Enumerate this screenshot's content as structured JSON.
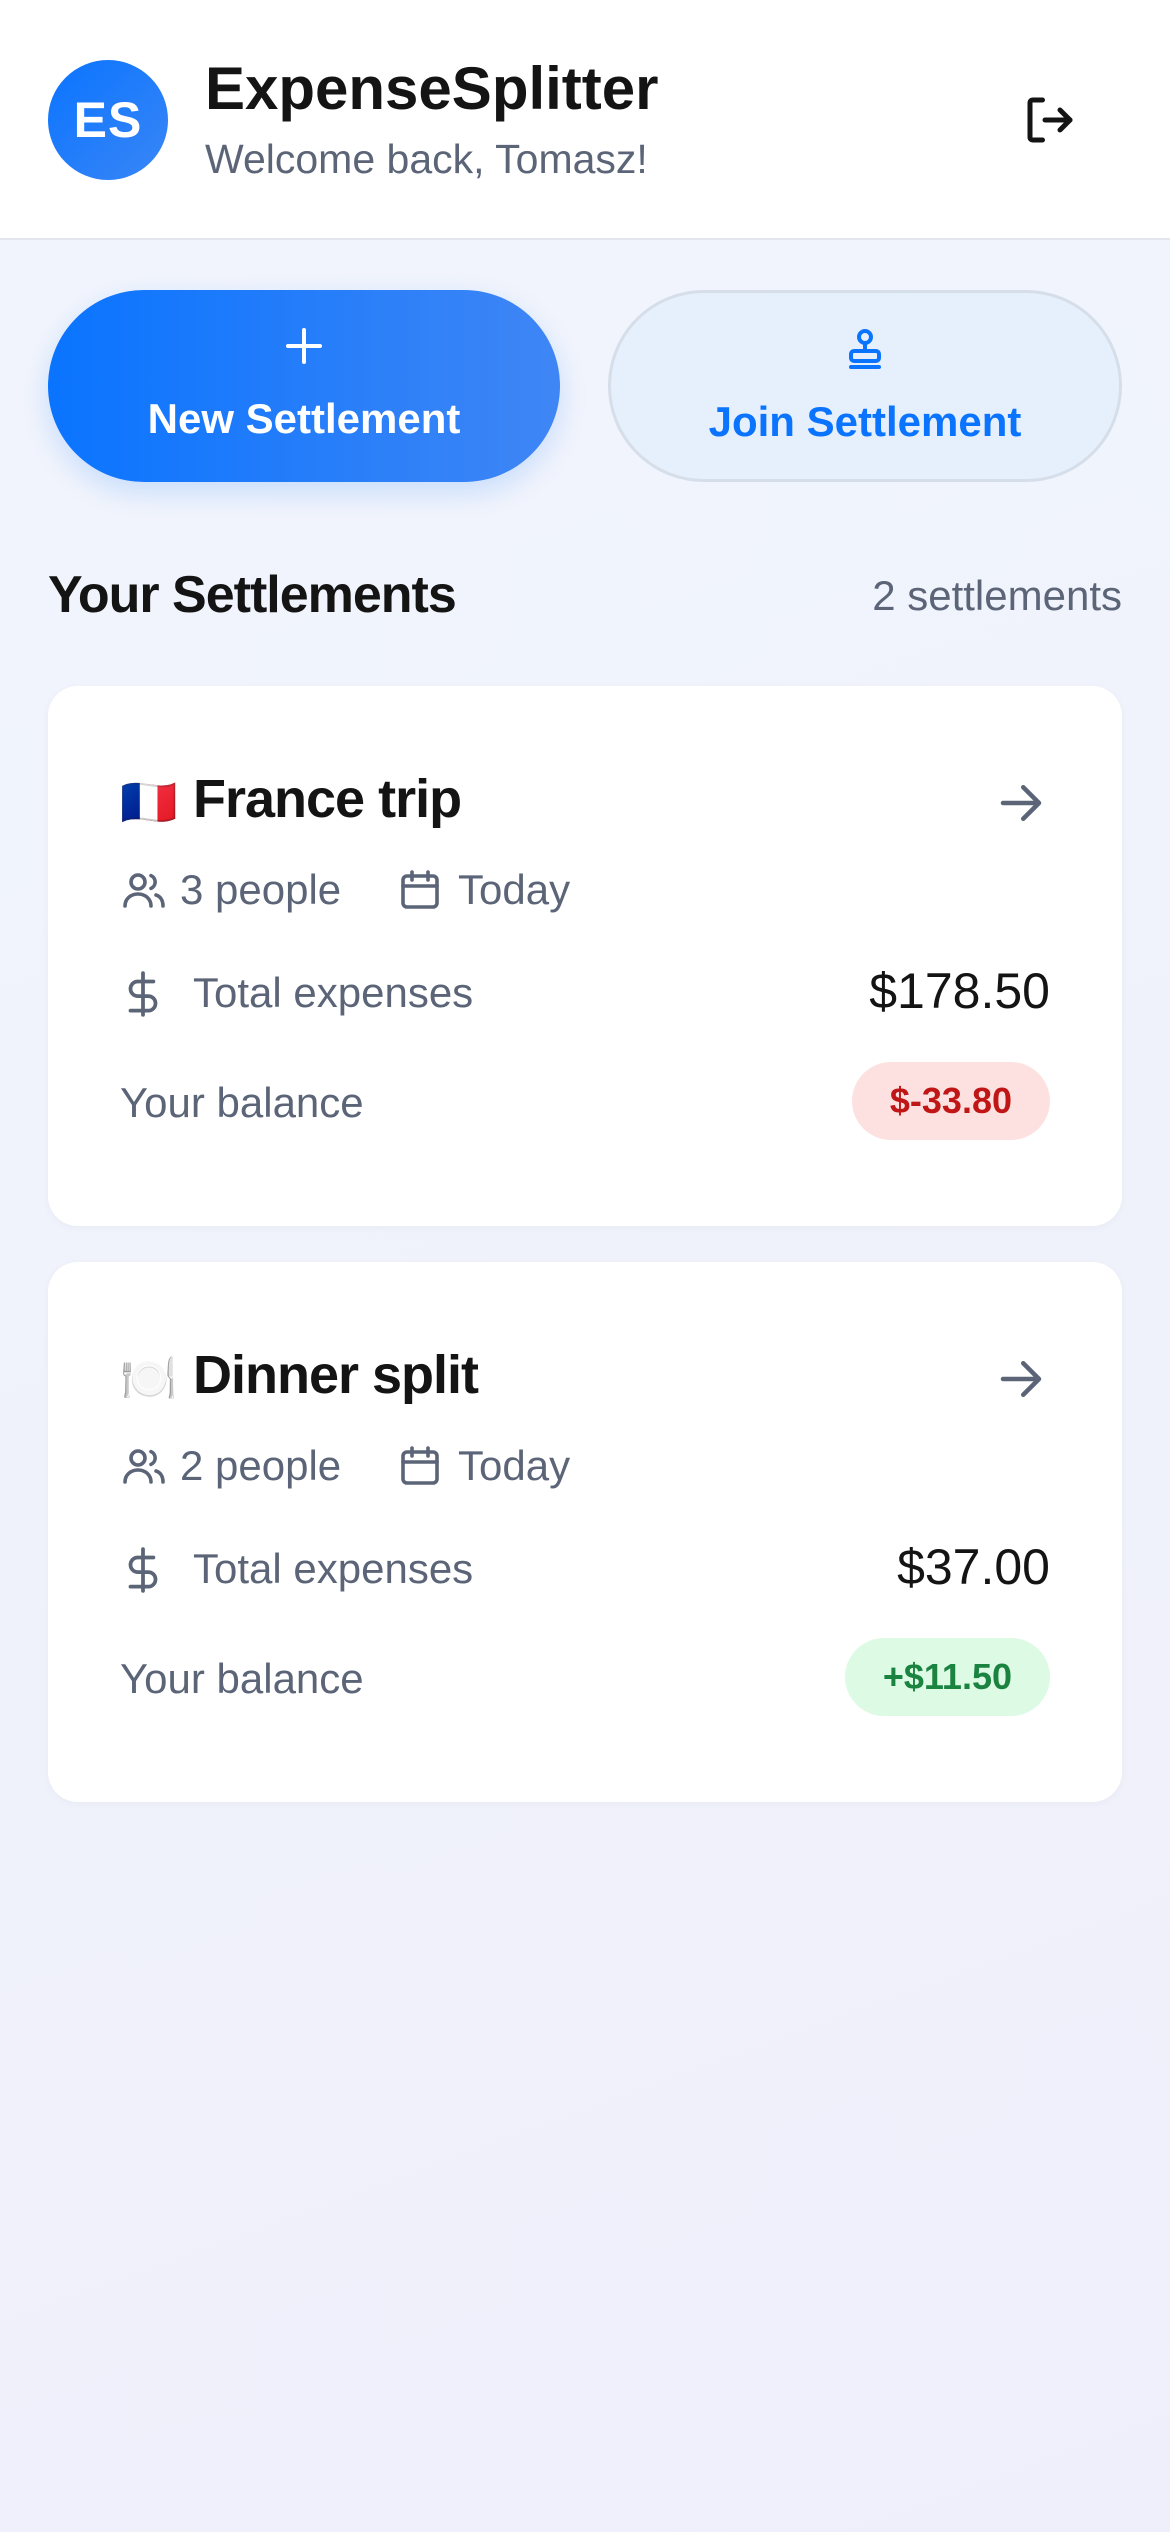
{
  "header": {
    "avatar_initials": "ES",
    "app_title": "ExpenseSplitter",
    "welcome": "Welcome back, Tomasz!",
    "logout_icon": "logout-icon"
  },
  "actions": {
    "new_label": "New Settlement",
    "new_icon": "plus-icon",
    "join_label": "Join Settlement",
    "join_icon": "stamp-icon"
  },
  "section": {
    "title": "Your Settlements",
    "count": "2 settlements"
  },
  "settlements": [
    {
      "emoji": "🇫🇷",
      "title": "France trip",
      "people": "3 people",
      "date": "Today",
      "total_label": "Total expenses",
      "total": "$178.50",
      "balance_label": "Your balance",
      "balance": "$-33.80",
      "balance_type": "negative"
    },
    {
      "emoji": "🍽️",
      "title": "Dinner split",
      "people": "2 people",
      "date": "Today",
      "total_label": "Total expenses",
      "total": "$37.00",
      "balance_label": "Your balance",
      "balance": "+$11.50",
      "balance_type": "positive"
    }
  ],
  "colors": {
    "primary": "#0a74ff",
    "negative_bg": "#fde1e1",
    "negative_text": "#c01616",
    "positive_bg": "#dcfae4",
    "positive_text": "#1b8340"
  }
}
